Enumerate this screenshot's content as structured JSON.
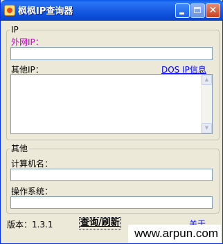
{
  "window": {
    "title": "枫枫IP查询器"
  },
  "ip_group": {
    "legend": "IP",
    "external_ip_label": "外网IP：",
    "external_ip_value": "",
    "other_ip_label": "其他IP：",
    "dos_link": "DOS IP信息",
    "other_ip_value": ""
  },
  "other_group": {
    "legend": "其他",
    "computer_name_label": "计算机名：",
    "computer_name_value": "",
    "os_label": "操作系统：",
    "os_value": ""
  },
  "footer": {
    "version_text": "版本：1.3.1",
    "query_button": "查询/刷新",
    "about_link": "关于",
    "watermark": "www.arpun.com"
  },
  "colors": {
    "title_bar": "#0a5ae8",
    "window_bg": "#ece9d8",
    "external_ip_label": "#cc00cc",
    "link": "#0000ff"
  }
}
